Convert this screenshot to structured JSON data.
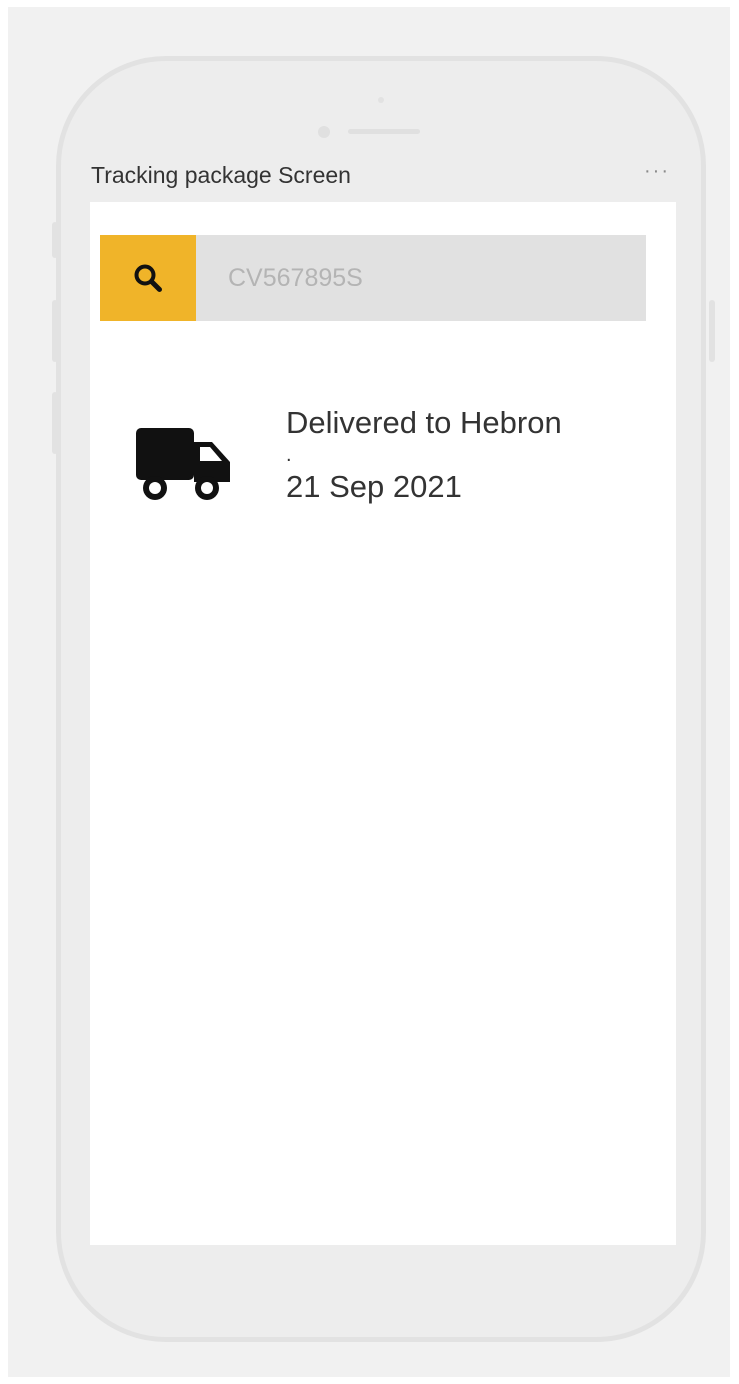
{
  "frame": {
    "title": "Tracking package Screen",
    "menu_label": "···"
  },
  "search": {
    "icon": "search-icon",
    "placeholder": "CV567895S",
    "value": ""
  },
  "result": {
    "icon": "truck-icon",
    "status": "Delivered to Hebron",
    "separator": ".",
    "date": "21 Sep 2021"
  },
  "colors": {
    "accent": "#f0b429",
    "search_bg": "#e1e1e1",
    "text": "#333333"
  }
}
